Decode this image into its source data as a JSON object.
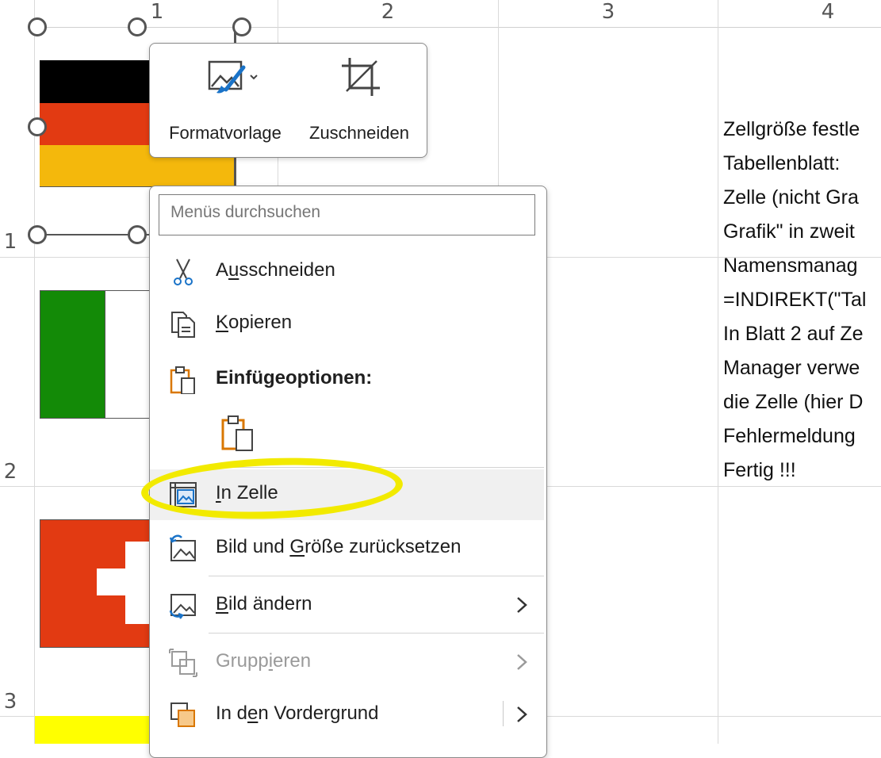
{
  "columns": [
    "1",
    "2",
    "3",
    "4"
  ],
  "rows": [
    "1",
    "2",
    "3"
  ],
  "sheet_text_lines": [
    "Zellgröße festle",
    "Tabellenblatt:",
    "Zelle (nicht Gra",
    "Grafik\" in zweit",
    "Namensmanag",
    "=INDIREKT(\"Tal",
    "In Blatt 2 auf Ze",
    "Manager verwe",
    "die Zelle (hier D",
    "Fehlermeldung",
    "Fertig !!!"
  ],
  "mini_toolbar": {
    "style_label": "Formatvorlage",
    "crop_label": "Zuschneiden"
  },
  "context_menu": {
    "search_placeholder": "Menüs durchsuchen",
    "cut": {
      "pre": "A",
      "ul": "u",
      "post": "sschneiden"
    },
    "copy": {
      "pre": "",
      "ul": "K",
      "post": "opieren"
    },
    "paste_options": "Einfügeoptionen:",
    "in_cell": {
      "pre": "",
      "ul": "I",
      "post": "n Zelle"
    },
    "reset": {
      "pre": "Bild und ",
      "ul": "G",
      "post": "röße zurücksetzen"
    },
    "change": {
      "pre": "",
      "ul": "B",
      "post": "ild ändern"
    },
    "group": {
      "pre": "Grupp",
      "ul": "i",
      "post": "eren"
    },
    "front": {
      "pre": "In d",
      "ul": "e",
      "post": "n Vordergrund"
    }
  },
  "colors": {
    "highlight": "#f2ea00",
    "flag_black": "#000000",
    "flag_red": "#e23a12",
    "flag_gold": "#f4b80c",
    "flag_green": "#138a07",
    "accent_blue": "#1a73c8",
    "accent_orange": "#d97700"
  },
  "icons": [
    "format-style-icon",
    "crop-icon",
    "scissors-icon",
    "copy-icon",
    "paste-icon",
    "paste-picture-icon",
    "in-cell-icon",
    "reset-picture-icon",
    "change-picture-icon",
    "group-icon",
    "bring-forward-icon",
    "chevron-right-icon"
  ]
}
